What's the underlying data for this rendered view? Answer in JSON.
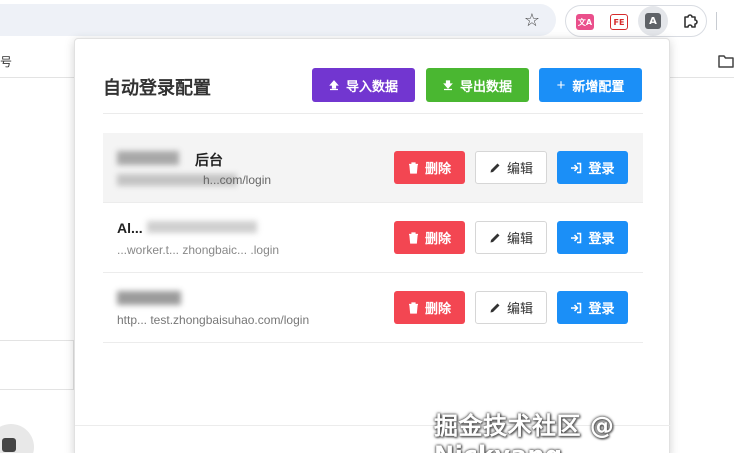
{
  "browser": {
    "bookmark_fragment": "号",
    "extensions": {
      "translate": "文A",
      "fe": "FE",
      "active": "A"
    }
  },
  "popup": {
    "title": "自动登录配置",
    "buttons": {
      "import": "导入数据",
      "export": "导出数据",
      "add": "新增配置"
    },
    "row_actions": {
      "delete": "删除",
      "edit": "编辑",
      "login": "登录"
    },
    "rows": [
      {
        "name": "后台",
        "url": "h...com/login"
      },
      {
        "name": "Al...",
        "url": "...worker.t... zhongbaic... .login"
      },
      {
        "name": "",
        "url": "http... test.zhongbaisuhao.com/login"
      }
    ]
  },
  "watermark": "掘金技术社区 @ Nickyang"
}
